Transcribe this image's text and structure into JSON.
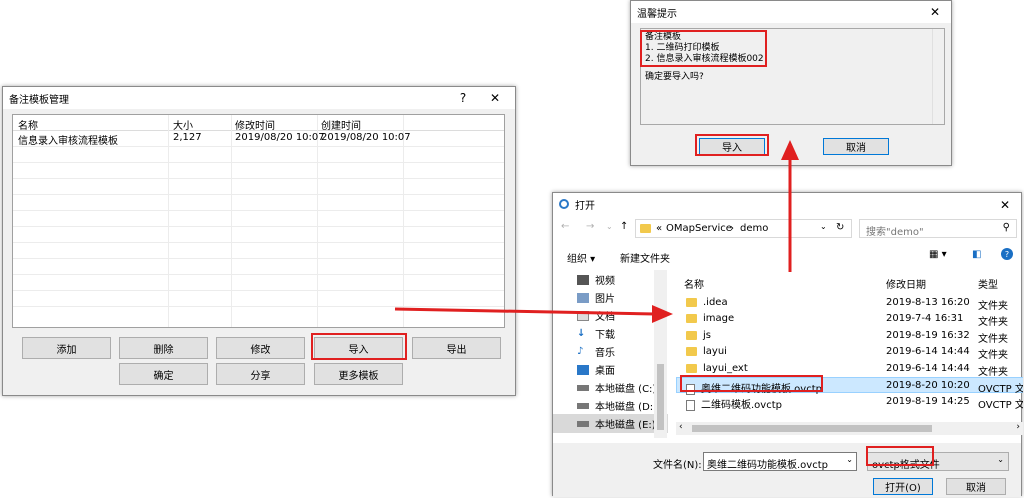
{
  "template_window": {
    "title": "备注模板管理",
    "help": "?",
    "close": "✕",
    "columns": [
      "名称",
      "大小",
      "修改时间",
      "创建时间"
    ],
    "rows": [
      {
        "name": "信息录入审核流程模板",
        "size": "2,127",
        "modified": "2019/08/20 10:07",
        "created": "2019/08/20 10:07"
      }
    ],
    "buttons_row1": [
      "添加",
      "删除",
      "修改",
      "导入",
      "导出"
    ],
    "buttons_row2": [
      "确定",
      "分享",
      "更多模板"
    ]
  },
  "confirm_dialog": {
    "title": "温馨提示",
    "close": "✕",
    "lines": [
      "备注模板",
      "1. 二维码打印模板",
      "2. 信息录入审核流程模板002"
    ],
    "question": "确定要导入吗?",
    "ok": "导入",
    "cancel": "取消"
  },
  "open_dialog": {
    "title": "打开",
    "close": "✕",
    "path_prefix": "«",
    "path": [
      "OMapService",
      "demo"
    ],
    "search_placeholder": "搜索\"demo\"",
    "toolbar": {
      "organize": "组织 ▾",
      "new_folder": "新建文件夹"
    },
    "nav": [
      "视频",
      "图片",
      "文档",
      "下载",
      "音乐",
      "桌面",
      "本地磁盘 (C:)",
      "本地磁盘 (D:)",
      "本地磁盘 (E:)"
    ],
    "columns": [
      "名称",
      "修改日期",
      "类型"
    ],
    "files": [
      {
        "name": ".idea",
        "date": "2019-8-13 16:20",
        "type": "文件夹",
        "kind": "folder"
      },
      {
        "name": "image",
        "date": "2019-7-4 16:31",
        "type": "文件夹",
        "kind": "folder"
      },
      {
        "name": "js",
        "date": "2019-8-19 16:32",
        "type": "文件夹",
        "kind": "folder"
      },
      {
        "name": "layui",
        "date": "2019-6-14 14:44",
        "type": "文件夹",
        "kind": "folder"
      },
      {
        "name": "layui_ext",
        "date": "2019-6-14 14:44",
        "type": "文件夹",
        "kind": "folder"
      },
      {
        "name": "奥维二维码功能模板.ovctp",
        "date": "2019-8-20 10:20",
        "type": "OVCTP 文件",
        "kind": "file"
      },
      {
        "name": "二维码模板.ovctp",
        "date": "2019-8-19 14:25",
        "type": "OVCTP 文件",
        "kind": "file"
      }
    ],
    "filename_label": "文件名(N):",
    "filename_value": "奥维二维码功能模板.ovctp",
    "filetype_value": "ovctp格式文件",
    "open": "打开(O)",
    "cancel": "取消"
  },
  "colors": {
    "annotation": "#e02020",
    "selected": "#cce8ff",
    "folder": "#f2c94c"
  }
}
